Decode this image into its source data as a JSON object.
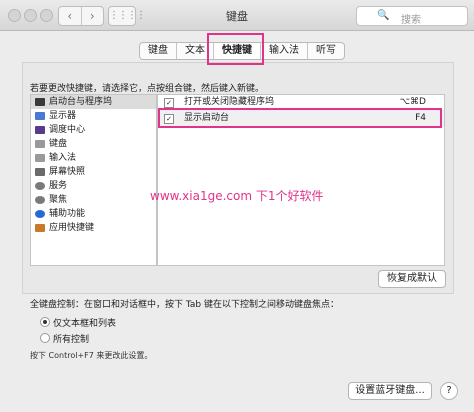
{
  "window": {
    "title": "键盘"
  },
  "search": {
    "placeholder": "搜索",
    "icon": "search-icon"
  },
  "nav": {
    "back": "‹",
    "forward": "›",
    "grid": "⋮⋮⋮⋮"
  },
  "tabs": [
    {
      "label": "键盘",
      "active": false
    },
    {
      "label": "文本",
      "active": false
    },
    {
      "label": "快捷键",
      "active": true
    },
    {
      "label": "输入法",
      "active": false
    },
    {
      "label": "听写",
      "active": false
    }
  ],
  "instruction": "若要更改快捷键，请选择它，点按组合键，然后键入新键。",
  "categories": [
    {
      "label": "启动台与程序坞",
      "icon": "launchpad-icon",
      "color": "#3a3a3a",
      "selected": true
    },
    {
      "label": "显示器",
      "icon": "display-icon",
      "color": "#4a7bd0",
      "selected": false
    },
    {
      "label": "调度中心",
      "icon": "mission-control-icon",
      "color": "#5a3a8a",
      "selected": false
    },
    {
      "label": "键盘",
      "icon": "keyboard-icon",
      "color": "#9a9a9a",
      "selected": false
    },
    {
      "label": "输入法",
      "icon": "input-source-icon",
      "color": "#9a9a9a",
      "selected": false
    },
    {
      "label": "屏幕快照",
      "icon": "screenshot-icon",
      "color": "#6a6a6a",
      "selected": false
    },
    {
      "label": "服务",
      "icon": "services-icon",
      "color": "#7a7a7a",
      "selected": false
    },
    {
      "label": "聚焦",
      "icon": "spotlight-icon",
      "color": "#7a7a7a",
      "selected": false
    },
    {
      "label": "辅助功能",
      "icon": "accessibility-icon",
      "color": "#2a6ad0",
      "selected": false
    },
    {
      "label": "应用快捷键",
      "icon": "app-shortcuts-icon",
      "color": "#c87a2a",
      "selected": false
    }
  ],
  "shortcuts": [
    {
      "checked": "✓",
      "label": "打开或关闭隐藏程序坞",
      "key": "⌥⌘D"
    },
    {
      "checked": "✓",
      "label": "显示启动台",
      "key": "F4"
    }
  ],
  "restore_button": "恢复成默认",
  "keyboard_control": {
    "title": "全键盘控制：在窗口和对话框中，按下 Tab 键在以下控制之间移动键盘焦点：",
    "options": [
      {
        "label": "仅文本框和列表",
        "selected": true
      },
      {
        "label": "所有控制",
        "selected": false
      }
    ],
    "note": "按下 Control+F7 来更改此设置。"
  },
  "bluetooth_button": "设置蓝牙键盘...",
  "help_button": "?",
  "watermark": "www.xia1ge.com 下1个好软件",
  "colors": {
    "highlight": "#e0338a"
  }
}
